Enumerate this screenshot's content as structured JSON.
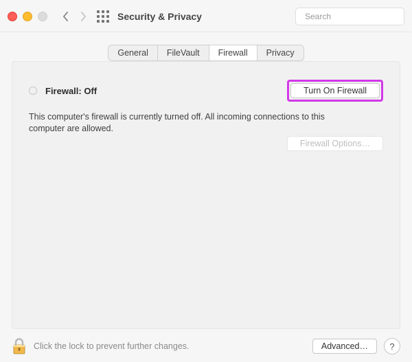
{
  "titlebar": {
    "title": "Security & Privacy",
    "search_placeholder": "Search"
  },
  "tabs": {
    "general": "General",
    "filevault": "FileVault",
    "firewall": "Firewall",
    "privacy": "Privacy"
  },
  "firewall": {
    "status_label": "Firewall: Off",
    "turn_on_label": "Turn On Firewall",
    "description": "This computer's firewall is currently turned off. All incoming connections to this computer are allowed.",
    "options_label": "Firewall Options…"
  },
  "footer": {
    "lock_text": "Click the lock to prevent further changes.",
    "advanced_label": "Advanced…",
    "help_label": "?"
  }
}
